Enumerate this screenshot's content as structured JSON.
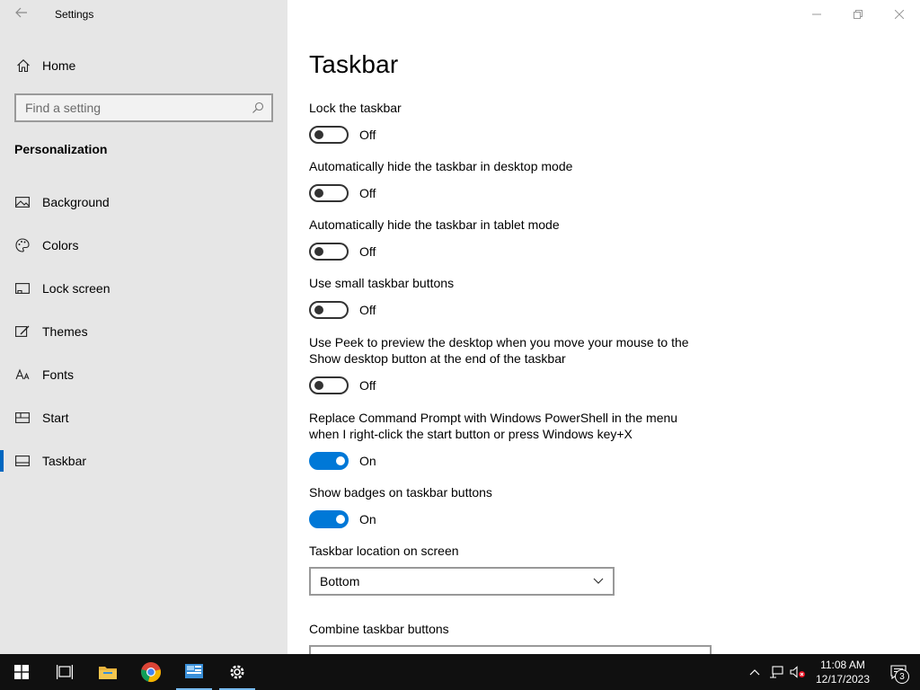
{
  "app": {
    "title": "Settings"
  },
  "sidebar": {
    "home_label": "Home",
    "search_placeholder": "Find a setting",
    "section_title": "Personalization",
    "items": [
      {
        "label": "Background",
        "icon": "image-icon"
      },
      {
        "label": "Colors",
        "icon": "palette-icon"
      },
      {
        "label": "Lock screen",
        "icon": "lock-screen-icon"
      },
      {
        "label": "Themes",
        "icon": "brush-icon"
      },
      {
        "label": "Fonts",
        "icon": "font-icon"
      },
      {
        "label": "Start",
        "icon": "start-icon"
      },
      {
        "label": "Taskbar",
        "icon": "taskbar-icon",
        "active": true
      }
    ]
  },
  "main": {
    "title": "Taskbar",
    "settings": [
      {
        "label": "Lock the taskbar",
        "state": "Off"
      },
      {
        "label": "Automatically hide the taskbar in desktop mode",
        "state": "Off"
      },
      {
        "label": "Automatically hide the taskbar in tablet mode",
        "state": "Off"
      },
      {
        "label": "Use small taskbar buttons",
        "state": "Off"
      },
      {
        "label": "Use Peek to preview the desktop when you move your mouse to the Show desktop button at the end of the taskbar",
        "state": "Off"
      },
      {
        "label": "Replace Command Prompt with Windows PowerShell in the menu when I right-click the start button or press Windows key+X",
        "state": "On"
      },
      {
        "label": "Show badges on taskbar buttons",
        "state": "On"
      }
    ],
    "location": {
      "label": "Taskbar location on screen",
      "value": "Bottom"
    },
    "combine": {
      "label": "Combine taskbar buttons"
    }
  },
  "taskbar": {
    "time": "11:08 AM",
    "date": "12/17/2023",
    "notification_count": "3"
  },
  "colors": {
    "accent": "#0078d7",
    "sidebar_bg": "#e6e6e6",
    "taskbar_bg": "#101010"
  }
}
